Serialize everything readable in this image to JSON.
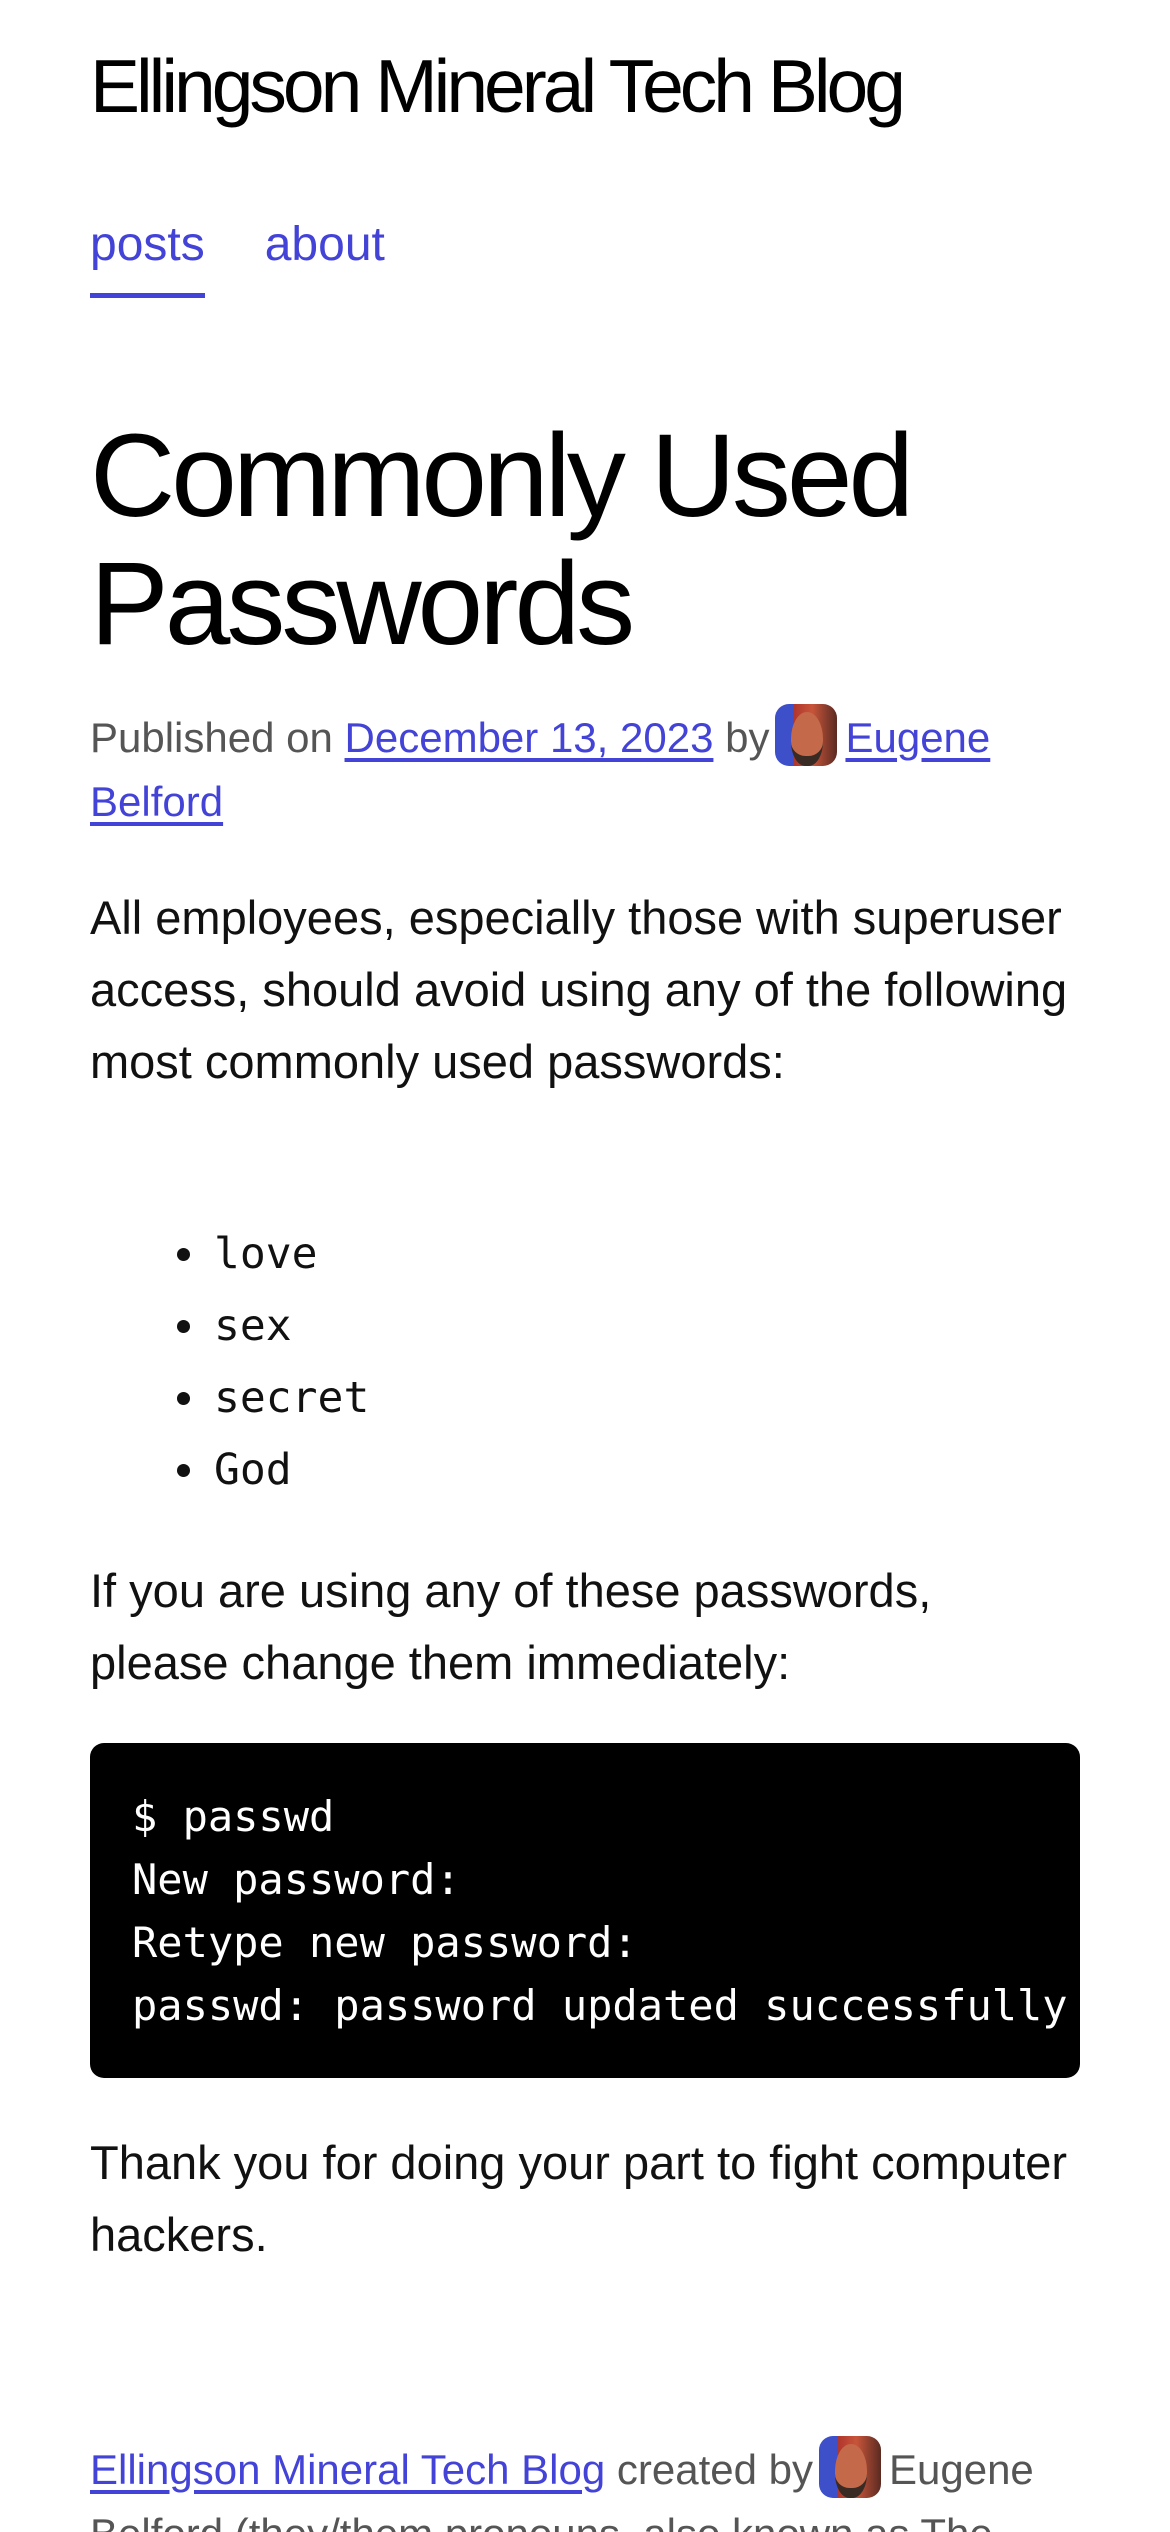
{
  "site": {
    "title": "Ellingson Mineral Tech Blog"
  },
  "nav": {
    "items": [
      {
        "label": "posts",
        "active": true
      },
      {
        "label": "about",
        "active": false
      }
    ],
    "accent_color": "#4343d8"
  },
  "post": {
    "title": "Commonly Used Passwords",
    "meta": {
      "published_prefix": "Published on",
      "date": "December 13, 2023",
      "by": "by",
      "author": "Eugene Belford",
      "avatar_icon": "author-avatar"
    },
    "intro": "All employees, especially those with superuser access, should avoid using any of the following most commonly used passwords:",
    "passwords": [
      "love",
      "sex",
      "secret",
      "God"
    ],
    "instruction": "If you are using any of these passwords, please change them immediately:",
    "code_lines": [
      "$ passwd",
      "New password:",
      "Retype new password:",
      "passwd: password updated successfully"
    ],
    "closing": "Thank you for doing your part to fight computer hackers."
  },
  "footer": {
    "site_link": "Ellingson Mineral Tech Blog",
    "created_by": "created by",
    "author_text": "Eugene Belford (they/them pronouns, also known as The"
  }
}
